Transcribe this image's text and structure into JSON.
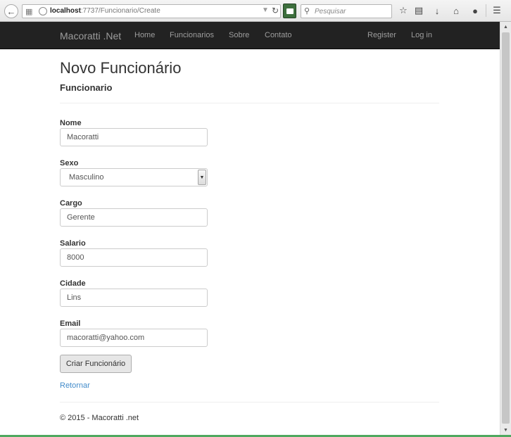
{
  "browser": {
    "url_host": "localhost",
    "url_path": ":7737/Funcionario/Create",
    "search_placeholder": "Pesquisar"
  },
  "navbar": {
    "brand": "Macoratti .Net",
    "links": [
      "Home",
      "Funcionarios",
      "Sobre",
      "Contato"
    ],
    "right_links": [
      "Register",
      "Log in"
    ]
  },
  "page": {
    "title": "Novo Funcionário",
    "subtitle": "Funcionario"
  },
  "form": {
    "nome": {
      "label": "Nome",
      "value": "Macoratti"
    },
    "sexo": {
      "label": "Sexo",
      "value": "Masculino"
    },
    "cargo": {
      "label": "Cargo",
      "value": "Gerente"
    },
    "salario": {
      "label": "Salario",
      "value": "8000"
    },
    "cidade": {
      "label": "Cidade",
      "value": "Lins"
    },
    "email": {
      "label": "Email",
      "value": "macoratti@yahoo.com"
    },
    "submit_label": "Criar Funcionário"
  },
  "back_link": "Retornar",
  "footer": "© 2015 - Macoratti .net",
  "colors": {
    "navbar_bg": "#222222",
    "navbar_text": "#9d9d9d",
    "link": "#428bca"
  },
  "icons": [
    "back-arrow-icon",
    "identity-icon",
    "globe-icon",
    "dropdown-icon",
    "reload-icon",
    "addon-icon",
    "search-icon",
    "bookmark-star-icon",
    "reading-list-icon",
    "download-icon",
    "home-icon",
    "chat-icon",
    "menu-icon",
    "select-arrow-icon"
  ]
}
